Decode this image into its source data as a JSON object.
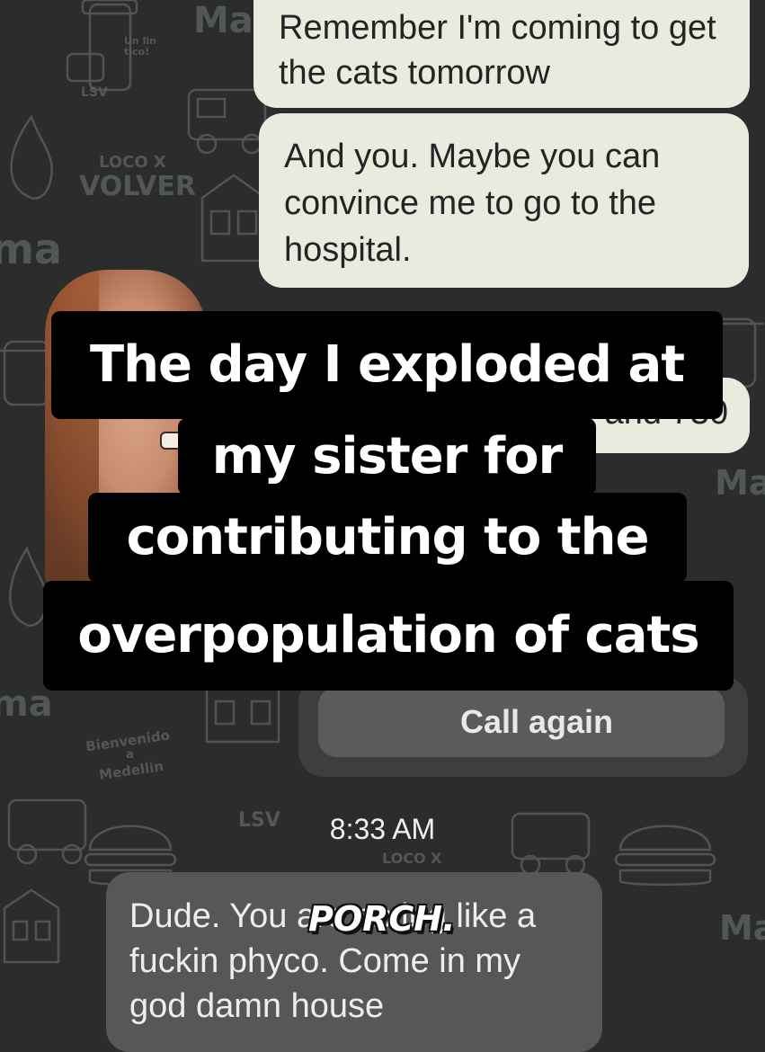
{
  "wallpaper": {
    "doodle_labels": [
      "Ma",
      "ma",
      "Ma",
      "ma",
      "Ma",
      "VOLVER",
      "LOCO X",
      "LOCO X",
      "Bienvenido",
      "a",
      "Medellin",
      "Un lin tico!",
      "LSV",
      "LSV"
    ]
  },
  "messages": {
    "out_1": "Remember I'm coming to get the cats tomorrow",
    "out_2": "And you. Maybe you can convince me to go to the hospital.",
    "out_3_partial": "and 730",
    "in_1": "Dude. You are acting like a fuckin phyco. Come in my god damn house"
  },
  "call_card": {
    "button_label": "Call again"
  },
  "timestamp": "8:33 AM",
  "caption": {
    "lines": [
      "The day I exploded at",
      "my sister for",
      "contributing to the",
      "overpopulation of cats"
    ]
  },
  "sticker": {
    "text": "PORCH."
  },
  "colors": {
    "background": "#2b2d2c",
    "outgoing_bubble": "#ebeadf",
    "incoming_bubble": "#565756",
    "caption_bg": "#000000",
    "caption_text": "#ffffff"
  }
}
